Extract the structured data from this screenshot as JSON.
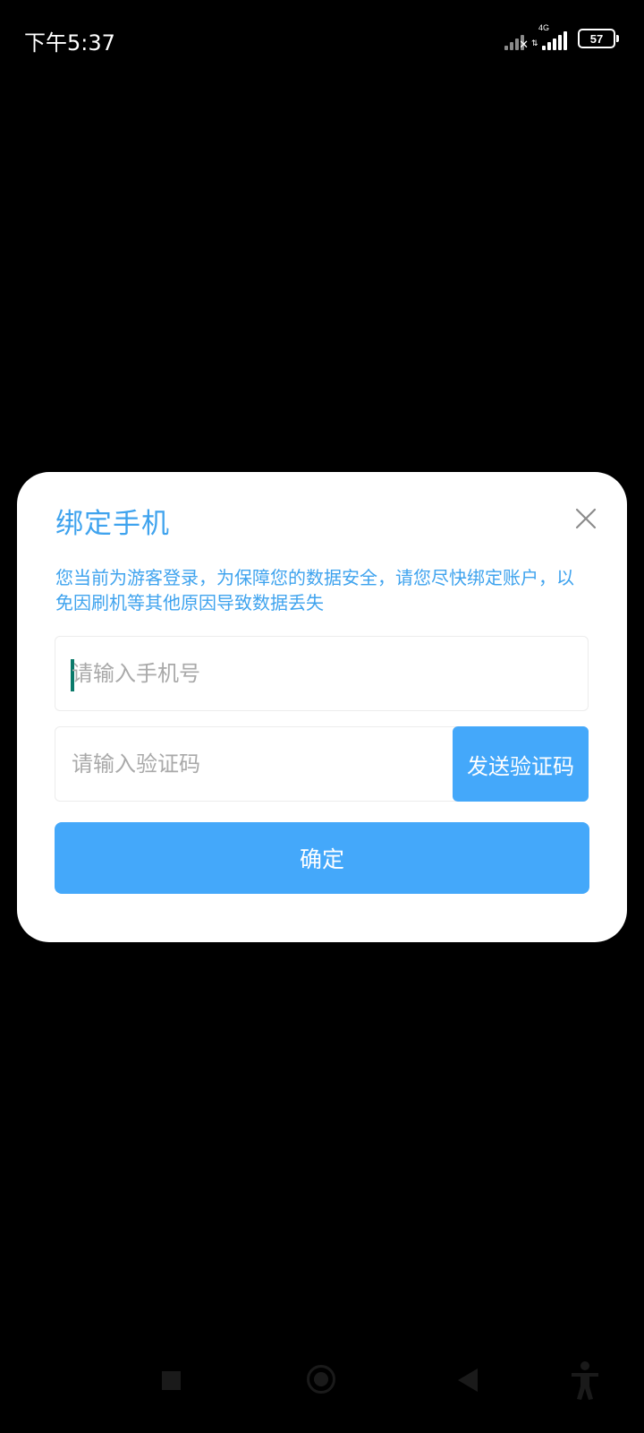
{
  "status_bar": {
    "time": "下午5:37",
    "network_type": "4G",
    "battery_level": "57"
  },
  "dialog": {
    "title": "绑定手机",
    "description": "您当前为游客登录，为保障您的数据安全，请您尽快绑定账户，以免因刷机等其他原因导致数据丢失",
    "phone_input": {
      "placeholder": "请输入手机号",
      "value": ""
    },
    "code_input": {
      "placeholder": "请输入验证码",
      "value": ""
    },
    "send_code_label": "发送验证码",
    "confirm_label": "确定"
  },
  "colors": {
    "accent": "#44a8fa",
    "title_text": "#3fa3ee",
    "background": "#000000",
    "dialog_bg": "#ffffff"
  },
  "icons": {
    "close": "close-icon",
    "nav_recent": "square-icon",
    "nav_home": "circle-icon",
    "nav_back": "triangle-back-icon",
    "accessibility": "accessibility-icon"
  }
}
